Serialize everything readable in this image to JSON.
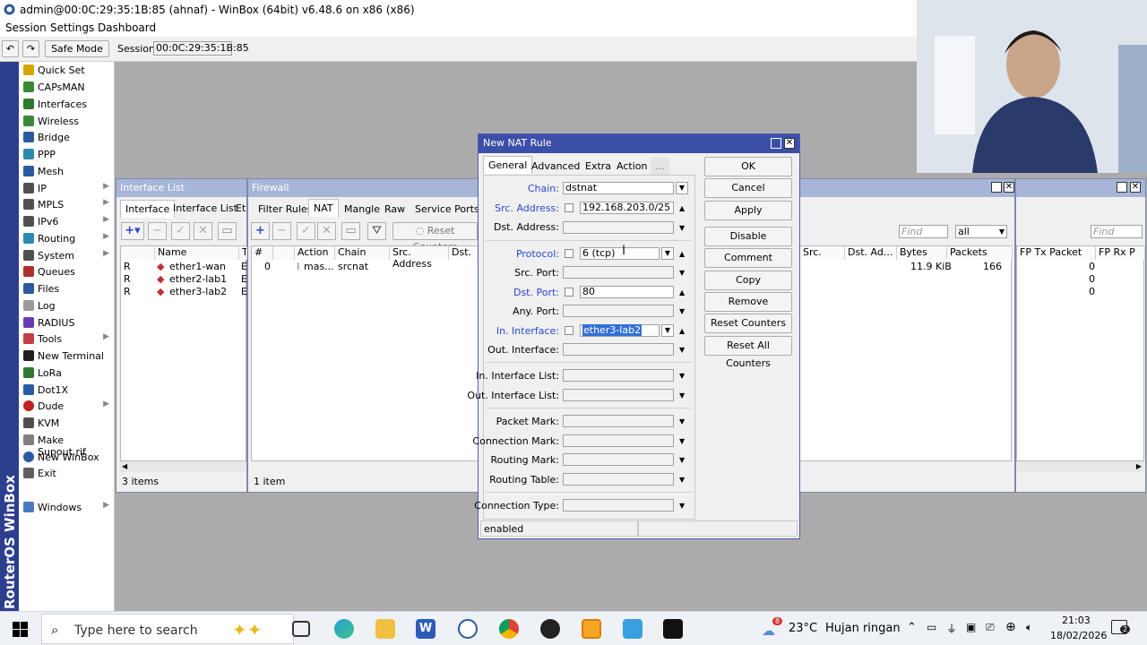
{
  "window": {
    "title": "admin@00:0C:29:35:1B:85 (ahnaf) - WinBox (64bit) v6.48.6 on x86 (x86)"
  },
  "menu": [
    "Session",
    "Settings",
    "Dashboard"
  ],
  "toolbar": {
    "safe_mode": "Safe Mode",
    "session_label": "Session:",
    "session_value": "00:0C:29:35:1B:85"
  },
  "brand": "RouterOS WinBox",
  "sidebar": [
    {
      "label": "Quick Set",
      "icon": "quick-set-icon",
      "color": "#d9a400",
      "arrow": false
    },
    {
      "label": "CAPsMAN",
      "icon": "capsman-icon",
      "color": "#3a8a3a",
      "arrow": false
    },
    {
      "label": "Interfaces",
      "icon": "interfaces-icon",
      "color": "#2f7a2f",
      "arrow": false
    },
    {
      "label": "Wireless",
      "icon": "wireless-icon",
      "color": "#3a8a3a",
      "arrow": false
    },
    {
      "label": "Bridge",
      "icon": "bridge-icon",
      "color": "#2a5aa0",
      "arrow": false
    },
    {
      "label": "PPP",
      "icon": "ppp-icon",
      "color": "#2a8ab0",
      "arrow": false
    },
    {
      "label": "Mesh",
      "icon": "mesh-icon",
      "color": "#2a5aa0",
      "arrow": false
    },
    {
      "label": "IP",
      "icon": "ip-icon",
      "color": "#505050",
      "arrow": true
    },
    {
      "label": "MPLS",
      "icon": "mpls-icon",
      "color": "#505050",
      "arrow": true
    },
    {
      "label": "IPv6",
      "icon": "ipv6-icon",
      "color": "#505050",
      "arrow": true
    },
    {
      "label": "Routing",
      "icon": "routing-icon",
      "color": "#2a8ab0",
      "arrow": true
    },
    {
      "label": "System",
      "icon": "system-icon",
      "color": "#505050",
      "arrow": true
    },
    {
      "label": "Queues",
      "icon": "queues-icon",
      "color": "#b03030",
      "arrow": false
    },
    {
      "label": "Files",
      "icon": "files-icon",
      "color": "#2a5aa0",
      "arrow": false
    },
    {
      "label": "Log",
      "icon": "log-icon",
      "color": "#9a9a9a",
      "arrow": false
    },
    {
      "label": "RADIUS",
      "icon": "radius-icon",
      "color": "#6a3ab0",
      "arrow": false
    },
    {
      "label": "Tools",
      "icon": "tools-icon",
      "color": "#c04040",
      "arrow": true
    },
    {
      "label": "New Terminal",
      "icon": "terminal-icon",
      "color": "#202020",
      "arrow": false
    },
    {
      "label": "LoRa",
      "icon": "lora-icon",
      "color": "#2f7a2f",
      "arrow": false
    },
    {
      "label": "Dot1X",
      "icon": "dot1x-icon",
      "color": "#2a5aa0",
      "arrow": false
    },
    {
      "label": "Dude",
      "icon": "dude-icon",
      "color": "#c02020",
      "arrow": true
    },
    {
      "label": "KVM",
      "icon": "kvm-icon",
      "color": "#505050",
      "arrow": false
    },
    {
      "label": "Make Supout.rif",
      "icon": "supout-icon",
      "color": "#808080",
      "arrow": false
    },
    {
      "label": "New WinBox",
      "icon": "winbox-icon",
      "color": "#2a5aa0",
      "arrow": false
    },
    {
      "label": "Exit",
      "icon": "exit-icon",
      "color": "#606060",
      "arrow": false
    },
    {
      "label": "Windows",
      "icon": "windows-icon",
      "color": "#4a7ac0",
      "arrow": true
    }
  ],
  "interface_list": {
    "title": "Interface List",
    "tabs": [
      "Interface",
      "Interface List",
      "Et"
    ],
    "headers": [
      "",
      "Name",
      "T"
    ],
    "rows": [
      {
        "flag": "R",
        "name": "ether1-wan",
        "t": "E"
      },
      {
        "flag": "R",
        "name": "ether2-lab1",
        "t": "E"
      },
      {
        "flag": "R",
        "name": "ether3-lab2",
        "t": "E"
      }
    ],
    "status": "3 items"
  },
  "firewall": {
    "title": "Firewall",
    "tabs": [
      "Filter Rules",
      "NAT",
      "Mangle",
      "Raw",
      "Service Ports"
    ],
    "reset_counters": "Reset Counters",
    "headers": [
      "#",
      "Action",
      "Chain",
      "Src. Address",
      "Dst. Ad"
    ],
    "rows": [
      {
        "num": "0",
        "action": "mas...",
        "chain": "srcnat"
      }
    ],
    "status": "1 item",
    "right_headers": [
      "Src. Ad...",
      "Dst. Ad...",
      "Bytes",
      "Packets"
    ],
    "right_row": {
      "bytes": "11.9 KiB",
      "packets": "166"
    },
    "find_placeholder": "Find",
    "filter_value": "all"
  },
  "third_window": {
    "headers": [
      "FP Tx Packet (p/s)",
      "FP Rx P"
    ],
    "values": [
      "0",
      "0",
      "0"
    ],
    "find_placeholder": "Find"
  },
  "dialog": {
    "title": "New NAT Rule",
    "tabs": [
      "General",
      "Advanced",
      "Extra",
      "Action",
      "..."
    ],
    "fields": {
      "chain": {
        "label": "Chain:",
        "value": "dstnat"
      },
      "src_address": {
        "label": "Src. Address:",
        "value": "192.168.203.0/25"
      },
      "dst_address": {
        "label": "Dst. Address:",
        "value": ""
      },
      "protocol": {
        "label": "Protocol:",
        "value": "6 (tcp)"
      },
      "src_port": {
        "label": "Src. Port:",
        "value": ""
      },
      "dst_port": {
        "label": "Dst. Port:",
        "value": "80"
      },
      "any_port": {
        "label": "Any. Port:",
        "value": ""
      },
      "in_interface": {
        "label": "In. Interface:",
        "value": "ether3-lab2"
      },
      "out_interface": {
        "label": "Out. Interface:",
        "value": ""
      },
      "in_interface_list": {
        "label": "In. Interface List:",
        "value": ""
      },
      "out_interface_list": {
        "label": "Out. Interface List:",
        "value": ""
      },
      "packet_mark": {
        "label": "Packet Mark:",
        "value": ""
      },
      "connection_mark": {
        "label": "Connection Mark:",
        "value": ""
      },
      "routing_mark": {
        "label": "Routing Mark:",
        "value": ""
      },
      "routing_table": {
        "label": "Routing Table:",
        "value": ""
      },
      "connection_type": {
        "label": "Connection Type:",
        "value": ""
      }
    },
    "buttons": [
      "OK",
      "Cancel",
      "Apply",
      "Disable",
      "Comment",
      "Copy",
      "Remove",
      "Reset Counters",
      "Reset All Counters"
    ],
    "status": "enabled"
  },
  "taskbar": {
    "search_placeholder": "Type here to search",
    "weather_temp": "23°C",
    "weather_text": "Hujan ringan",
    "weather_badge": "8",
    "time": "21:03",
    "date": "18/02/2026",
    "notification_count": "2"
  }
}
